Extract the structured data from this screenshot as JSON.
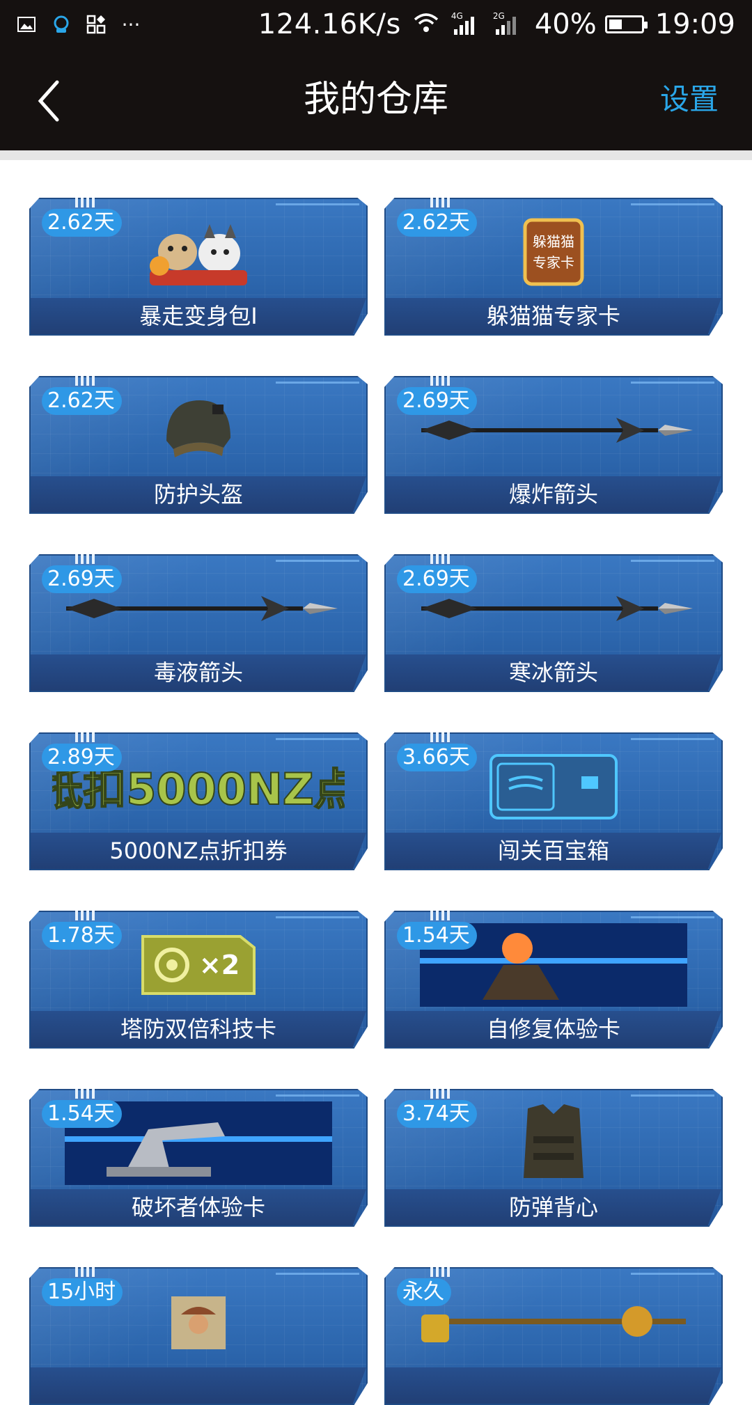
{
  "status_bar": {
    "speed": "124.16K/s",
    "net1": "4G",
    "net2": "2G",
    "battery": "40%",
    "battery_level": 0.4,
    "time": "19:09"
  },
  "header": {
    "title": "我的仓库",
    "settings_label": "设置"
  },
  "items": [
    {
      "duration": "2.62天",
      "name": "暴走变身包I",
      "art": "cat-dog-icon"
    },
    {
      "duration": "2.62天",
      "name": "躲猫猫专家卡",
      "art": "card-badge-icon",
      "art_text": "躲猫猫专家卡"
    },
    {
      "duration": "2.62天",
      "name": "防护头盔",
      "art": "helmet-icon"
    },
    {
      "duration": "2.69天",
      "name": "爆炸箭头",
      "art": "arrow-icon"
    },
    {
      "duration": "2.69天",
      "name": "毒液箭头",
      "art": "arrow-icon"
    },
    {
      "duration": "2.69天",
      "name": "寒冰箭头",
      "art": "arrow-icon"
    },
    {
      "duration": "2.89天",
      "name": "5000NZ点折扣券",
      "art": "coupon-icon",
      "art_text": "抵扣5000NZ点"
    },
    {
      "duration": "3.66天",
      "name": "闯关百宝箱",
      "art": "treasure-box-icon"
    },
    {
      "duration": "1.78天",
      "name": "塔防双倍科技卡",
      "art": "double-card-icon",
      "art_text": "×2"
    },
    {
      "duration": "1.54天",
      "name": "自修复体验卡",
      "art": "turret-icon"
    },
    {
      "duration": "1.54天",
      "name": "破坏者体验卡",
      "art": "cannon-icon"
    },
    {
      "duration": "3.74天",
      "name": "防弹背心",
      "art": "vest-icon"
    },
    {
      "duration": "15小时",
      "name": "",
      "art": "poster-icon"
    },
    {
      "duration": "永久",
      "name": "",
      "art": "weapon-icon"
    }
  ]
}
